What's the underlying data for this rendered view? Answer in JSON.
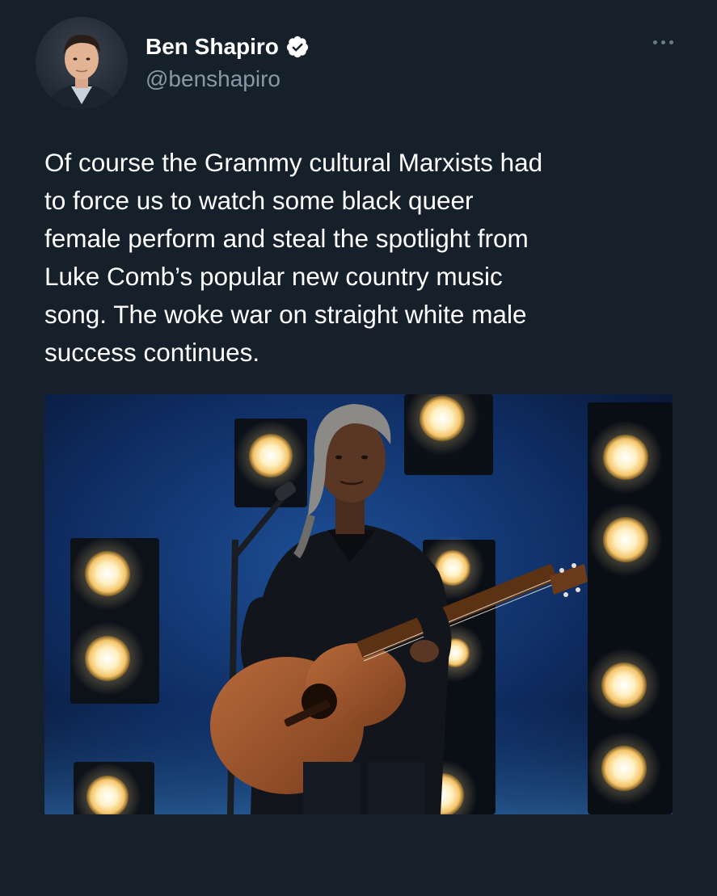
{
  "author": {
    "display_name": "Ben Shapiro",
    "handle": "@benshapiro",
    "avatar_icon": "profile-photo",
    "verified_icon": "verified-badge-icon"
  },
  "menu": {
    "icon": "more-options-icon"
  },
  "tweet": {
    "text": "Of course the Grammy cultural Marxists had\nto force us to watch some black queer\nfemale perform and steal the spotlight from\nLuke Comb’s popular new country music\nsong. The woke war on straight white male\nsuccess continues."
  },
  "media": {
    "type": "photo",
    "subject": "performer-with-guitar"
  },
  "colors": {
    "background": "#15202b",
    "text": "#ffffff",
    "secondary_text": "#8899a6",
    "verified_badge": "#ffffff"
  }
}
